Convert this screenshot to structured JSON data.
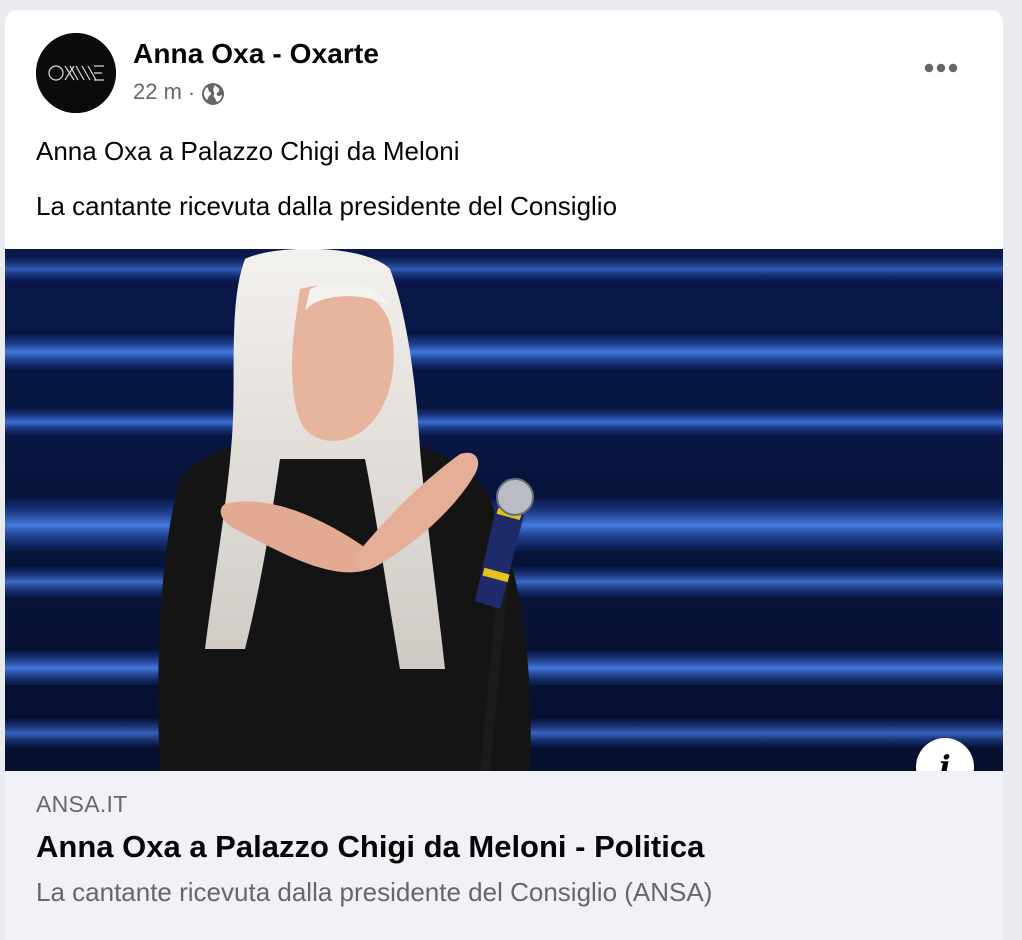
{
  "post": {
    "page_name": "Anna Oxa - Oxarte",
    "time": "22 m",
    "separator": "·",
    "avatar_text": "OXARTE",
    "lines": [
      "Anna Oxa a Palazzo Chigi da Meloni",
      "La cantante ricevuta dalla presidente del Consiglio"
    ],
    "privacy_icon": "globe-icon",
    "more_icon": "more-options-icon"
  },
  "link": {
    "domain": "ANSA.IT",
    "title": "Anna Oxa a Palazzo Chigi da Meloni - Politica",
    "description": "La cantante ricevuta dalla presidente del Consiglio (ANSA)",
    "info_label": "i"
  },
  "colors": {
    "background": "#e9ebee",
    "card": "#ffffff",
    "preview_bg": "#f0f2f5",
    "text_primary": "#050505",
    "text_secondary": "#65676b",
    "stage_blue": "#1e5bd6"
  }
}
